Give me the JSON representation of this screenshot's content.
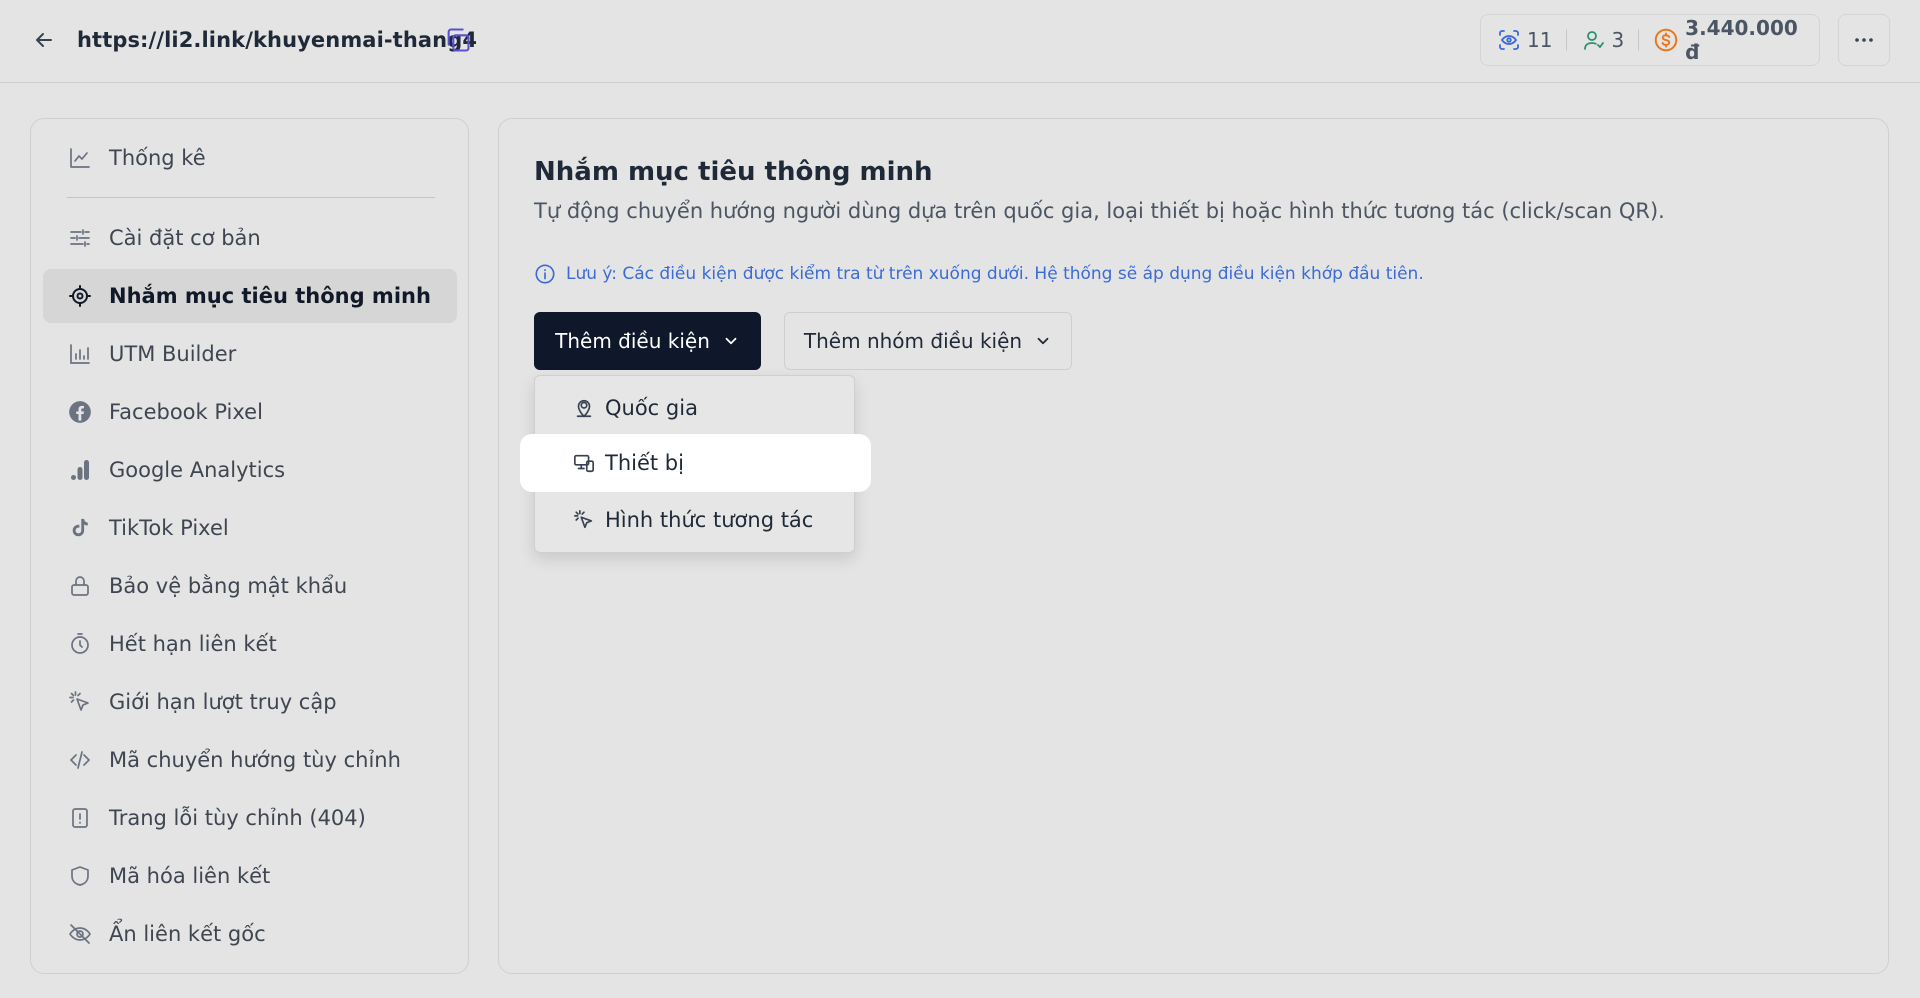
{
  "topbar": {
    "url": "https://li2.link/khuyenmai-thang4",
    "stats": {
      "views": "11",
      "users": "3",
      "revenue": "3.440.000 đ"
    }
  },
  "sidebar": {
    "items": [
      {
        "label": "Thống kê",
        "icon": "chart-line-icon"
      },
      {
        "label": "Cài đặt cơ bản",
        "icon": "sliders-icon"
      },
      {
        "label": "Nhắm mục tiêu thông minh",
        "icon": "crosshair-icon",
        "active": true
      },
      {
        "label": "UTM Builder",
        "icon": "bar-chart-icon"
      },
      {
        "label": "Facebook Pixel",
        "icon": "facebook-icon"
      },
      {
        "label": "Google Analytics",
        "icon": "google-analytics-icon"
      },
      {
        "label": "TikTok Pixel",
        "icon": "tiktok-icon"
      },
      {
        "label": "Bảo vệ bằng mật khẩu",
        "icon": "lock-icon"
      },
      {
        "label": "Hết hạn liên kết",
        "icon": "timer-icon"
      },
      {
        "label": "Giới hạn lượt truy cập",
        "icon": "click-icon"
      },
      {
        "label": "Mã chuyển hướng tùy chỉnh",
        "icon": "code-icon"
      },
      {
        "label": "Trang lỗi tùy chỉnh (404)",
        "icon": "file-alert-icon"
      },
      {
        "label": "Mã hóa liên kết",
        "icon": "shield-icon"
      },
      {
        "label": "Ẩn liên kết gốc",
        "icon": "eye-off-icon"
      }
    ]
  },
  "main": {
    "title": "Nhắm mục tiêu thông minh",
    "subtitle": "Tự động chuyển hướng người dùng dựa trên quốc gia, loại thiết bị hoặc hình thức tương tác (click/scan QR).",
    "note": "Lưu ý: Các điều kiện được kiểm tra từ trên xuống dưới. Hệ thống sẽ áp dụng điều kiện khớp đầu tiên.",
    "add_condition_label": "Thêm điều kiện",
    "add_group_label": "Thêm nhóm điều kiện",
    "dropdown": {
      "items": [
        {
          "label": "Quốc gia",
          "icon": "location-pin-icon"
        },
        {
          "label": "Thiết bị",
          "icon": "devices-icon",
          "highlighted": true
        },
        {
          "label": "Hình thức tương tác",
          "icon": "click-icon"
        }
      ]
    }
  },
  "colors": {
    "primary_button": "#0f172a",
    "note_blue": "#3b6bd6",
    "money_orange": "#e8771a",
    "copy_purple": "#5b4fd6",
    "stat_green": "#2f8f6f",
    "stat_blue": "#3b6bd6"
  }
}
